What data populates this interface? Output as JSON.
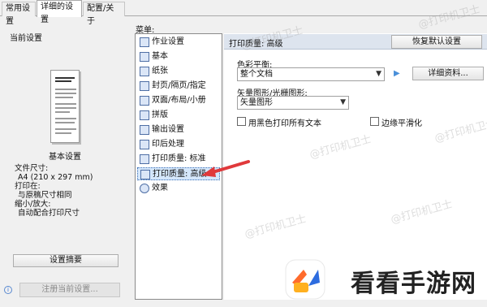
{
  "tabs": [
    {
      "label": "常用设置"
    },
    {
      "label": "详细的设置"
    },
    {
      "label": "配置/关于"
    }
  ],
  "left": {
    "current_settings_label": "当前设置",
    "basic_settings_label": "基本设置",
    "info": {
      "file_size_label": "文件尺寸:",
      "file_size_value": "A4 (210 x 297 mm)",
      "print_on_label": "打印在:",
      "print_on_value": "与原稿尺寸相同",
      "scale_label": "缩小/放大:",
      "scale_value": "自动配合打印尺寸"
    },
    "summary_button": "设置摘要",
    "register_button": "注册当前设置...",
    "info_icon": "info-icon"
  },
  "menu": {
    "label": "菜单:",
    "items": [
      {
        "label": "作业设置",
        "icon": "job-settings-icon"
      },
      {
        "label": "基本",
        "icon": "basic-icon"
      },
      {
        "label": "纸张",
        "icon": "paper-icon"
      },
      {
        "label": "封页/隔页/指定",
        "icon": "cover-icon"
      },
      {
        "label": "双面/布局/小册",
        "icon": "duplex-icon"
      },
      {
        "label": "拼版",
        "icon": "imposition-icon"
      },
      {
        "label": "输出设置",
        "icon": "output-icon"
      },
      {
        "label": "印后处理",
        "icon": "finishing-icon"
      },
      {
        "label": "打印质量: 标准",
        "icon": "quality-standard-icon"
      },
      {
        "label": "打印质量: 高级",
        "icon": "quality-advanced-icon"
      },
      {
        "label": "效果",
        "icon": "effects-icon"
      }
    ],
    "selected_index": 9
  },
  "right": {
    "section_title": "打印质量: 高级",
    "restore_button": "恢复默认设置",
    "color_balance_label": "色彩平衡:",
    "color_balance_value": "整个文档",
    "details_button": "详细资料...",
    "vector_label": "矢量图形/光栅图形:",
    "vector_value": "矢量图形",
    "black_text_label": "用黑色打印所有文本",
    "black_text_checked": false,
    "edge_smooth_label": "边缘平滑化",
    "edge_smooth_checked": false
  },
  "watermark": {
    "brand_text": "看看手游网",
    "tiled_text": "@打印机卫士"
  },
  "colors": {
    "annotation_arrow": "#e0393b",
    "selection_bg": "#d5e7fb",
    "header_bg": "#dde4ee",
    "logo_accent": "#ff6b2c",
    "logo_blue": "#2d6cdf"
  }
}
